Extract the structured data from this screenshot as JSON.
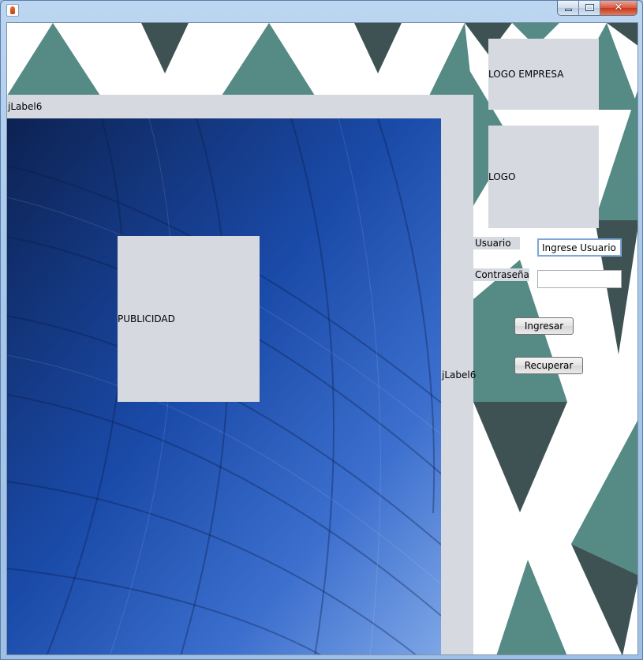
{
  "window": {
    "title": "",
    "icon": "java-cup-icon",
    "close_glyph": "✕"
  },
  "labels": {
    "top_label": "jLabel6",
    "right_label": "jLabel6",
    "publicidad": "PUBLICIDAD",
    "logo_empresa": "LOGO EMPRESA",
    "logo": "LOGO"
  },
  "form": {
    "usuario_label": "Usuario",
    "usuario_value": "Ingrese Usuario",
    "contrasena_label": "Contraseña",
    "contrasena_value": "",
    "ingresar_label": "Ingresar",
    "recuperar_label": "Recuperar"
  },
  "colors": {
    "teal": "#558a85",
    "dark_slate": "#3f5253",
    "panel_gray": "#d6d9e0",
    "blue_dark": "#0d2252",
    "blue_light": "#6f9be0"
  }
}
